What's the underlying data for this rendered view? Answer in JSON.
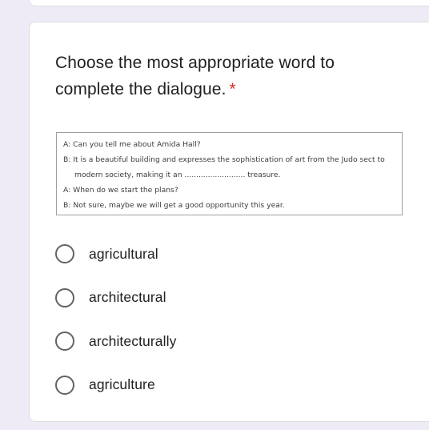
{
  "question": {
    "title": "Choose the most appropriate word to complete the dialogue.",
    "required_marker": "*"
  },
  "dialogue": [
    "A: Can you tell me about Amida Hall?",
    "B: It is a beautiful building and expresses the sophistication of art from the Judo sect to",
    "modern society, making it an .......................... treasure.",
    "A: When do we start the plans?",
    "B: Not sure, maybe we will get a good opportunity this year."
  ],
  "options": [
    {
      "label": "agricultural",
      "selected": false
    },
    {
      "label": "architectural",
      "selected": false
    },
    {
      "label": "architecturally",
      "selected": false
    },
    {
      "label": "agriculture",
      "selected": false
    }
  ]
}
